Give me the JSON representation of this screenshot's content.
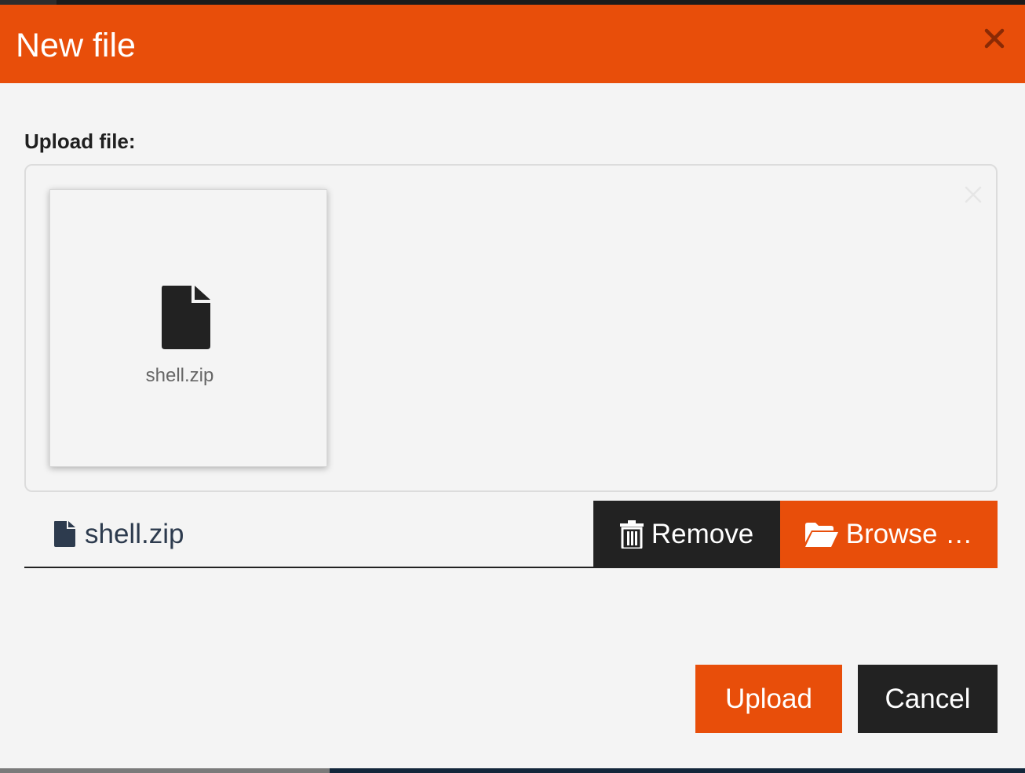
{
  "dialog": {
    "title": "New file",
    "close_icon": "close-icon"
  },
  "upload": {
    "label": "Upload file:",
    "preview": {
      "file_name": "shell.zip",
      "icon": "file-icon"
    },
    "caption": {
      "file_name": "shell.zip",
      "icon": "file-icon"
    },
    "buttons": {
      "remove": {
        "label": "Remove",
        "icon": "trash-icon"
      },
      "browse": {
        "label": "Browse …",
        "icon": "folder-open-icon"
      }
    }
  },
  "footer": {
    "upload_label": "Upload",
    "cancel_label": "Cancel"
  },
  "colors": {
    "accent": "#e84e0a",
    "dark": "#222222",
    "background": "#f4f4f4"
  }
}
